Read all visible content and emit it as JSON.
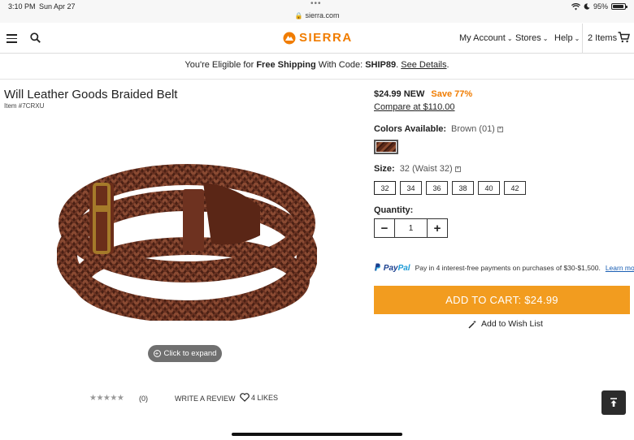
{
  "status_bar": {
    "time": "3:10 PM",
    "date": "Sun Apr 27",
    "dots": "•••",
    "url": "sierra.com",
    "battery": "95%",
    "battery_level": 0.95
  },
  "header": {
    "logo_text": "SIERRA",
    "nav": {
      "account": "My Account",
      "stores": "Stores",
      "help": "Help",
      "cart": "2 Items"
    }
  },
  "promo": {
    "prefix": "You're Eligible for ",
    "bold": "Free Shipping",
    "middle": " With Code: ",
    "code": "SHIP89",
    "suffix": ". ",
    "link": "See Details",
    "end": "."
  },
  "product": {
    "title": "Will Leather Goods Braided Belt",
    "item_no": "Item #7CRXU",
    "expand_label": "Click to expand",
    "reviews": {
      "stars": "★★★★★",
      "count": "(0)",
      "write_review": "WRITE A REVIEW",
      "likes": "4 LIKES"
    }
  },
  "purchase": {
    "price": "$24.99 NEW",
    "save": "Save 77%",
    "compare": "Compare at $110.00",
    "colors_label": "Colors Available:",
    "color_value": "Brown (01)",
    "size_label": "Size:",
    "size_value": "32 (Waist 32)",
    "sizes": [
      "32",
      "34",
      "36",
      "38",
      "40",
      "42"
    ],
    "quantity_label": "Quantity:",
    "quantity": "1",
    "qty_minus": "−",
    "qty_plus": "+",
    "paypal": {
      "logo_a": "P PayPal",
      "text": "Pay in 4 interest-free payments on purchases of $30-$1,500.",
      "link": "Learn more"
    },
    "add_to_cart": "ADD TO CART: $24.99",
    "wishlist": "Add to Wish List"
  },
  "colors": {
    "brand_orange": "#f07c00",
    "cart_button": "#f29c1f",
    "paypal_blue": "#1a3f8f"
  }
}
